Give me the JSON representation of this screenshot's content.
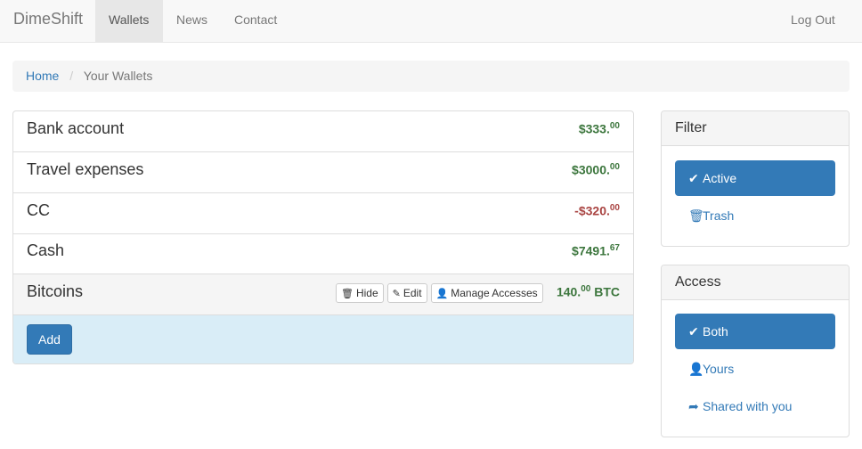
{
  "navbar": {
    "brand": "DimeShift",
    "items": [
      {
        "label": "Wallets",
        "active": true
      },
      {
        "label": "News",
        "active": false
      },
      {
        "label": "Contact",
        "active": false
      }
    ],
    "logout": "Log Out"
  },
  "breadcrumb": {
    "home": "Home",
    "separator": "/",
    "current": "Your Wallets"
  },
  "wallets": [
    {
      "name": "Bank account",
      "amount_main": "$333.",
      "amount_cents": "00",
      "status": "positive"
    },
    {
      "name": "Travel expenses",
      "amount_main": "$3000.",
      "amount_cents": "00",
      "status": "positive"
    },
    {
      "name": "CC",
      "amount_main": "-$320.",
      "amount_cents": "00",
      "status": "negative"
    },
    {
      "name": "Cash",
      "amount_main": "$7491.",
      "amount_cents": "67",
      "status": "positive"
    },
    {
      "name": "Bitcoins",
      "amount_main": "140.",
      "amount_cents": "00",
      "currency": " BTC",
      "status": "positive",
      "selected": true
    }
  ],
  "row_actions": {
    "hide_label": "Hide",
    "edit_label": "Edit",
    "manage_label": "Manage Accesses"
  },
  "add_button": "Add",
  "filter_panel": {
    "title": "Filter",
    "options": [
      {
        "label": "Active",
        "icon": "check-icon",
        "active": true
      },
      {
        "label": "Trash",
        "icon": "trash-icon",
        "active": false
      }
    ]
  },
  "access_panel": {
    "title": "Access",
    "options": [
      {
        "label": "Both",
        "icon": "check-icon",
        "active": true
      },
      {
        "label": "Yours",
        "icon": "user-icon",
        "active": false
      },
      {
        "label": "Shared with you",
        "icon": "share-icon",
        "active": false
      }
    ]
  },
  "colors": {
    "primary": "#337ab7",
    "positive": "#3c763d",
    "negative": "#a94442",
    "add_bg": "#d9edf7"
  }
}
